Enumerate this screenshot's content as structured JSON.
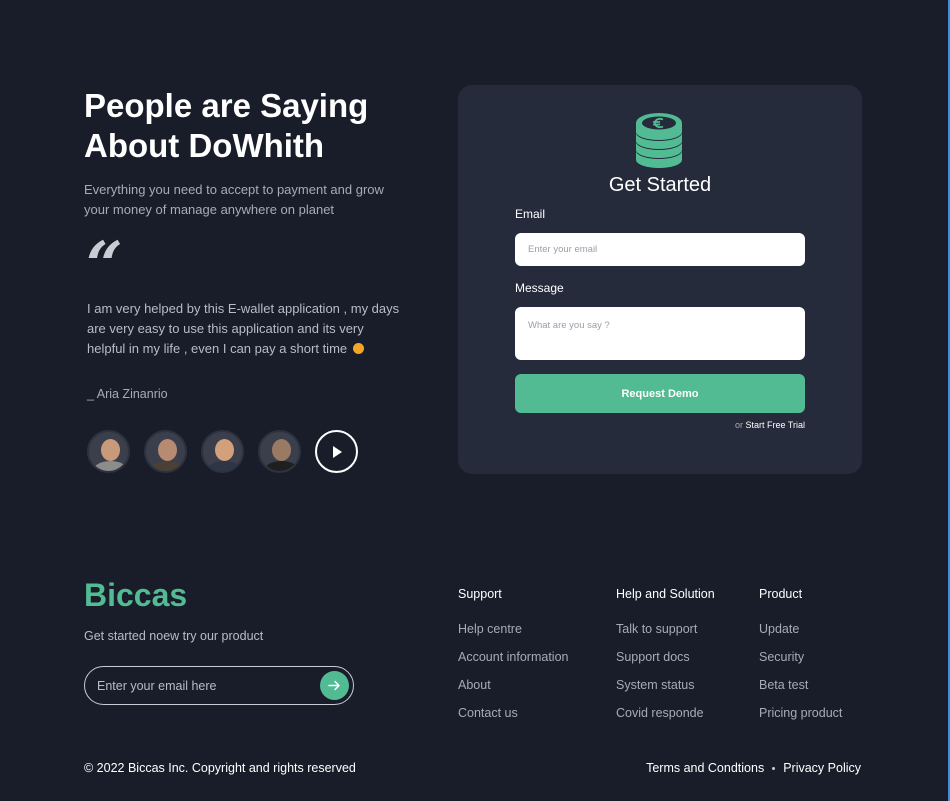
{
  "testimonial": {
    "title": "People are Saying About DoWhith",
    "subtitle": "Everything you need to accept to payment and grow your money of manage anywhere on planet",
    "quote_mark": "“",
    "quote": "I am very helped by this E-wallet application , my days are very easy to use this application and its very helpful in my life , even I can pay a short time",
    "author": "_ Aria Zinanrio",
    "avatars": [
      {
        "skin": "#c99a7a",
        "shirt": "#8c8c8c"
      },
      {
        "skin": "#b68b72",
        "shirt": "#4c4036"
      },
      {
        "skin": "#d3a07c",
        "shirt": "#2e3645"
      },
      {
        "skin": "#9b7a63",
        "shirt": "#1f1f1f"
      }
    ],
    "play_icon": "play-icon"
  },
  "form": {
    "icon": "coins-icon",
    "title": "Get Started",
    "email_label": "Email",
    "email_placeholder": "Enter your email",
    "message_label": "Message",
    "message_placeholder": "What are you say ?",
    "submit_label": "Request Demo",
    "trial_prefix": "or",
    "trial_link": "Start Free Trial"
  },
  "footer": {
    "brand": "Biccas",
    "tagline": "Get started noew try our product",
    "subscribe_placeholder": "Enter your email here",
    "subscribe_icon": "arrow-right-icon",
    "columns": [
      {
        "heading": "Support",
        "links": [
          "Help centre",
          "Account information",
          "About",
          "Contact us"
        ]
      },
      {
        "heading": "Help and Solution",
        "links": [
          "Talk to support",
          "Support docs",
          "System status",
          "Covid responde"
        ]
      },
      {
        "heading": "Product",
        "links": [
          "Update",
          "Security",
          "Beta test",
          "Pricing product"
        ]
      }
    ],
    "copyright": "© 2022 Biccas Inc. Copyright and rights reserved",
    "terms": "Terms and Condtions",
    "privacy": "Privacy Policy"
  },
  "colors": {
    "background": "#181d29",
    "card": "#252b3a",
    "accent": "#52bb94"
  }
}
